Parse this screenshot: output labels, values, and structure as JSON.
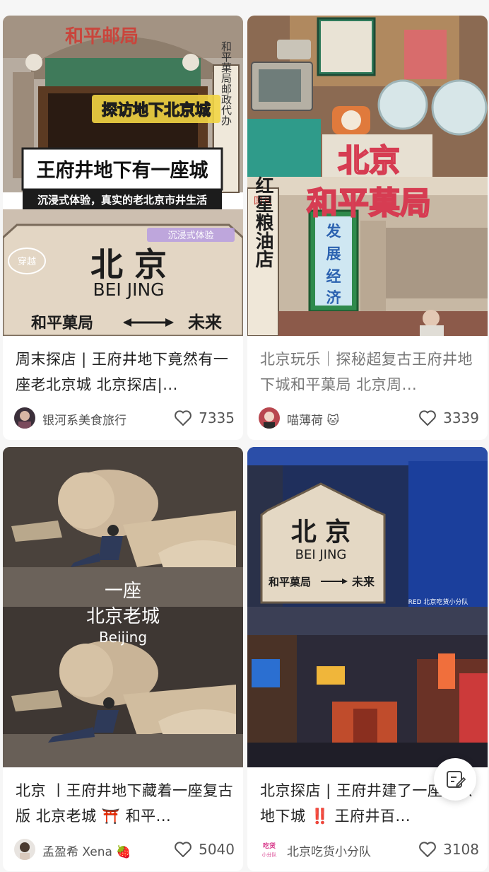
{
  "feed": {
    "cards": [
      {
        "cover": {
          "top_sign": "和平邮局",
          "vertical_sign": "和平菓局邮政代办",
          "banner": "探访地下北京城",
          "headline": "王府井地下有一座城",
          "subline": "沉浸式体验，真实的老北京市井生活",
          "tag": "沉浸式体验",
          "doodle": "穿越",
          "sign_city": "北  京",
          "sign_pinyin": "BEI JING",
          "sign_left": "和平菓局",
          "sign_right": "未来"
        },
        "title": "周末探店 | 王府井地下竟然有一座老北京城 北京探店|...",
        "author": "银河系美食旅行",
        "likes": "7335"
      },
      {
        "cover": {
          "overlay_1": "北京",
          "overlay_2": "和平菓局",
          "side_sign": "红星粮油店",
          "side_tag": "国营",
          "slogan": [
            "发",
            "展",
            "经",
            "济"
          ]
        },
        "title": "北京玩乐｜探秘超复古王府井地下城和平菓局 北京周...",
        "author": "喵薄荷 🐱",
        "likes": "3339"
      },
      {
        "cover": {
          "line_1": "一座",
          "line_2": "北京老城",
          "line_3": "Beijing"
        },
        "title": "北京 丨王府井地下藏着一座复古版 北京老城 ⛩️ 和平...",
        "author": "孟盈希 Xena 🍓",
        "likes": "5040"
      },
      {
        "cover": {
          "sign_city": "北  京",
          "sign_pinyin": "BEI JING",
          "sign_left": "和平菓局",
          "sign_right": "未来",
          "watermark": "RED 北京吃货小分队"
        },
        "title": "北京探店 | 王府井建了一座北京地下城 ‼️ 王府井百...",
        "author": "北京吃货小分队",
        "avatar_text": "吃货\n小分队",
        "likes": "3108"
      }
    ]
  },
  "fab": {
    "icon": "edit-note-icon"
  },
  "colors": {
    "banner_yellow": "#f2d544",
    "heart_stroke": "#555555",
    "sign_red": "#c0332b",
    "neon_green": "#2f8a4c"
  }
}
